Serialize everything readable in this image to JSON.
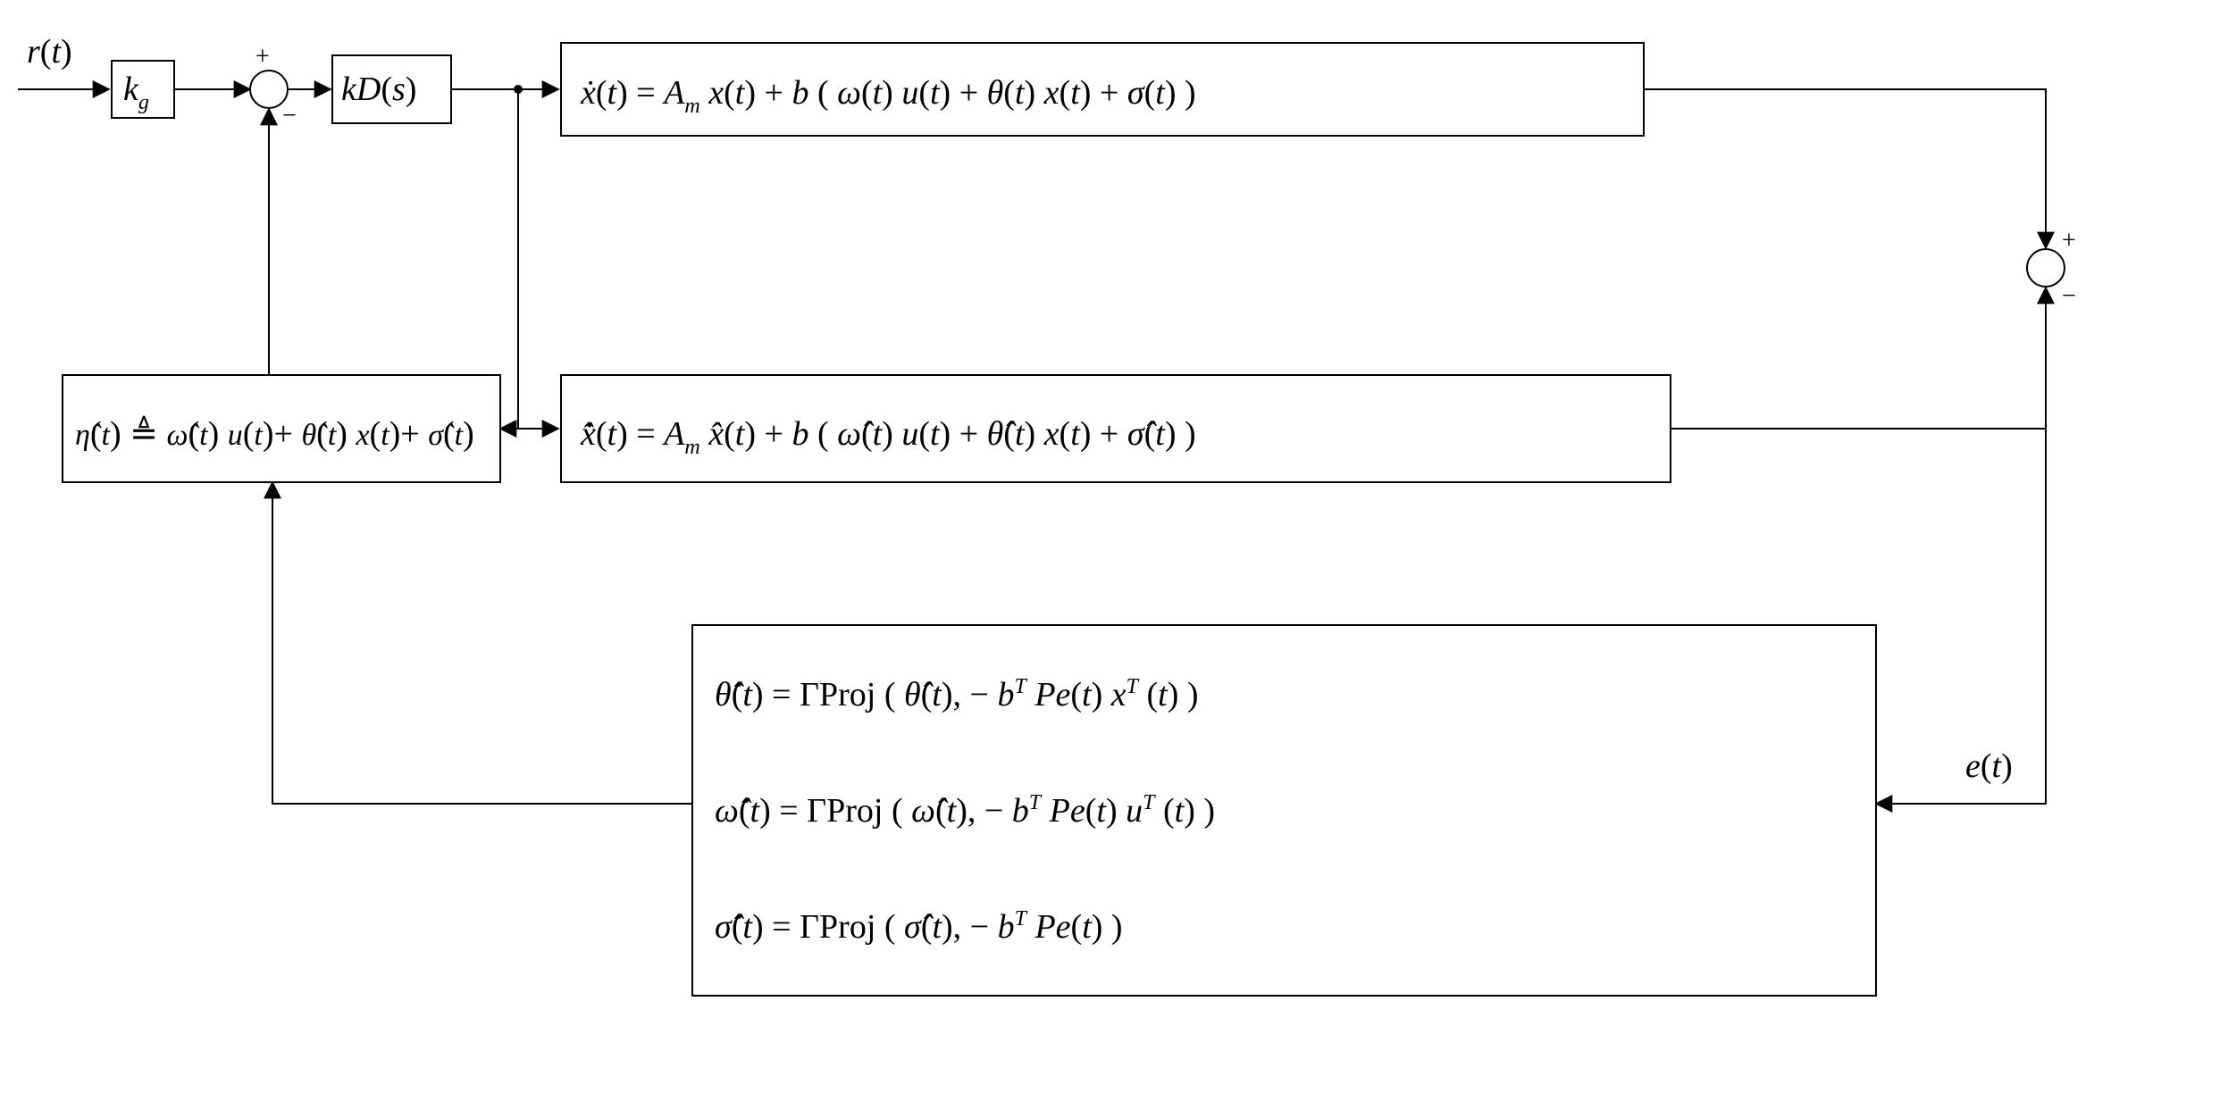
{
  "labels": {
    "r": "r(t)",
    "kg": "k_g",
    "kDs": "kD(s)",
    "plant": "ẋ(t) = A_m x(t) + b( ω(t)u(t) + θ(t)x(t) + σ(t) )",
    "predictor": "ẋ̂(t) = A_m x̂(t) + b( ω̂(t)u(t) + θ̂(t)x(t) + σ̂(t) )",
    "eta": "η̂(t) ≜ ω̂(t)u(t) + θ̂(t)x(t) + σ̂(t)",
    "law_theta": "θ̂̇(t) = ΓProj( θ̂(t), −b^T P e(t) x^T(t) )",
    "law_omega": "ω̂̇(t) = ΓProj( ω̂(t), −b^T P e(t) u^T(t) )",
    "law_sigma": "σ̂̇(t) = ΓProj( σ̂(t), −b^T P e(t) )",
    "e": "e(t)"
  },
  "signs": {
    "sum1_plus": "+",
    "sum1_minus": "−",
    "sum2_plus": "+",
    "sum2_minus": "−"
  },
  "diagram": {
    "description": "Block diagram of an L1 adaptive control architecture",
    "blocks": [
      {
        "id": "kg",
        "type": "gain",
        "label_key": "kg"
      },
      {
        "id": "sum1",
        "type": "sum",
        "inputs": [
          "+ from kg",
          "− from eta block"
        ],
        "output_to": "kDs"
      },
      {
        "id": "kDs",
        "type": "controller",
        "label_key": "kDs",
        "output_to": [
          "plant",
          "predictor",
          "eta"
        ]
      },
      {
        "id": "plant",
        "type": "plant_dynamics",
        "label_key": "plant",
        "output_to": "sum2 (+)"
      },
      {
        "id": "predictor",
        "type": "state_predictor",
        "label_key": "predictor",
        "output_to": "sum2 (−)"
      },
      {
        "id": "sum2",
        "type": "sum",
        "inputs": [
          "+ from plant",
          "− from predictor"
        ],
        "output_to": "adaptation_laws",
        "output_signal": "e(t)"
      },
      {
        "id": "adaptation_laws",
        "type": "adaptation_laws",
        "label_keys": [
          "law_theta",
          "law_omega",
          "law_sigma"
        ],
        "output_to": "eta"
      },
      {
        "id": "eta",
        "type": "adaptive_feedback",
        "label_key": "eta",
        "output_to": "sum1 (−)"
      }
    ],
    "external_input": {
      "signal": "r(t)",
      "into": "kg"
    }
  }
}
